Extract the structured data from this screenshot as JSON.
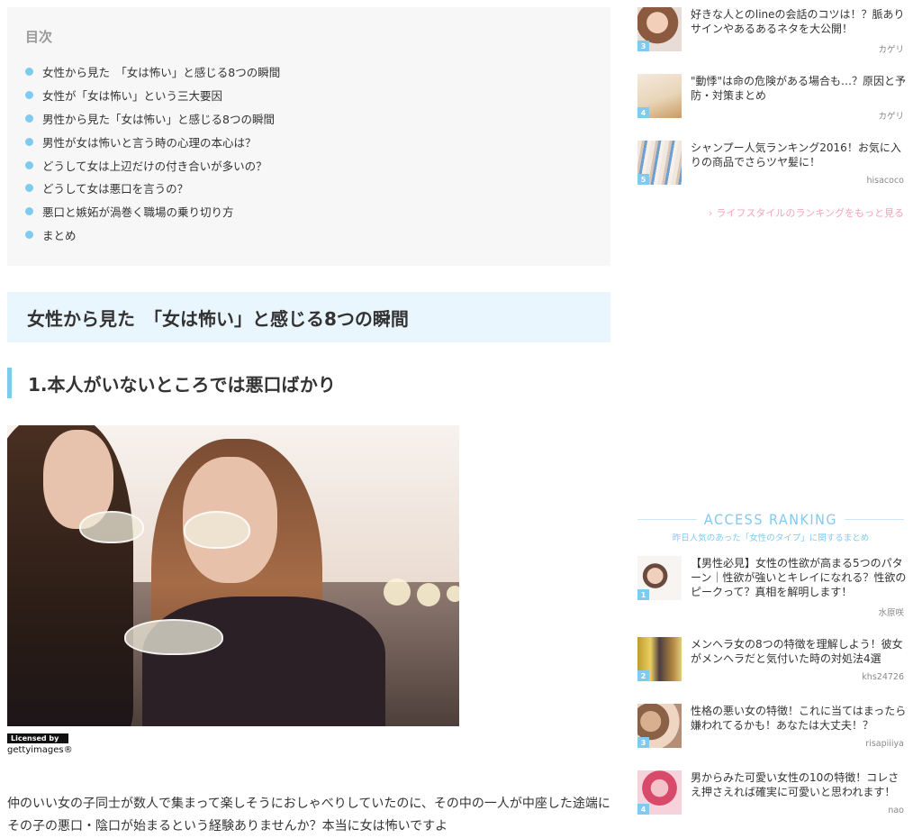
{
  "toc": {
    "title": "目次",
    "items": [
      "女性から見た　「女は怖い」と感じる8つの瞬間",
      "女性が「女は怖い」という三大要因",
      "男性から見た「女は怖い」と感じる8つの瞬間",
      "男性が女は怖いと言う時の心理の本心は？",
      "どうして女は上辺だけの付き合いが多いの？",
      "どうして女は悪口を言うの？",
      "悪口と嫉妬が渦巻く職場の乗り切り方",
      "まとめ"
    ]
  },
  "section": {
    "h2": "女性から見た　「女は怖い」と感じる8つの瞬間",
    "h3": "1.本人がいないところでは悪口ばかり"
  },
  "credit": {
    "badge": "Licensed by",
    "logo": "gettyimages®"
  },
  "body_text": "仲のいい女の子同士が数人で集まって楽しそうにおしゃべりしていたのに、その中の一人が中座した途端にその子の悪口・陰口が始まるという経験ありませんか？本当に女は怖いですよ",
  "sidebar_top": [
    {
      "rank": "3",
      "title": "好きな人とのlineの会話のコツは！？脈ありサインやあるあるネタを大公開！",
      "author": "カゲリ"
    },
    {
      "rank": "4",
      "title": "\"動悸\"は命の危険がある場合も…？原因と予防・対策まとめ",
      "author": "カゲリ"
    },
    {
      "rank": "5",
      "title": "シャンプー人気ランキング2016！お気に入りの商品でさらツヤ髪に！",
      "author": "hisacoco"
    }
  ],
  "more_link": "ライフスタイルのランキングをもっと見る",
  "access_ranking": {
    "title": "ACCESS RANKING",
    "subtitle": "昨日人気のあった「女性のタイプ」に関するまとめ",
    "items": [
      {
        "rank": "1",
        "title": "【男性必見】女性の性欲が高まる5つのパターン｜性欲が強いとキレイになれる？性欲のピークって？真相を解明します！",
        "author": "水原咲"
      },
      {
        "rank": "2",
        "title": "メンヘラ女の8つの特徴を理解しよう！彼女がメンヘラだと気付いた時の対処法4選",
        "author": "khs24726"
      },
      {
        "rank": "3",
        "title": "性格の悪い女の特徴！これに当てはまったら嫌われてるかも！あなたは大丈夫！？",
        "author": "risapiiiya"
      },
      {
        "rank": "4",
        "title": "男からみた可愛い女性の10の特徴！コレさえ押さえれば確実に可愛いと思われます！",
        "author": "nao"
      }
    ]
  },
  "colors": {
    "accent_blue": "#7fcbef",
    "h2_background": "#eaf6fd",
    "toc_background": "#f7f7f7",
    "more_link_pink": "#f5a4b8"
  }
}
